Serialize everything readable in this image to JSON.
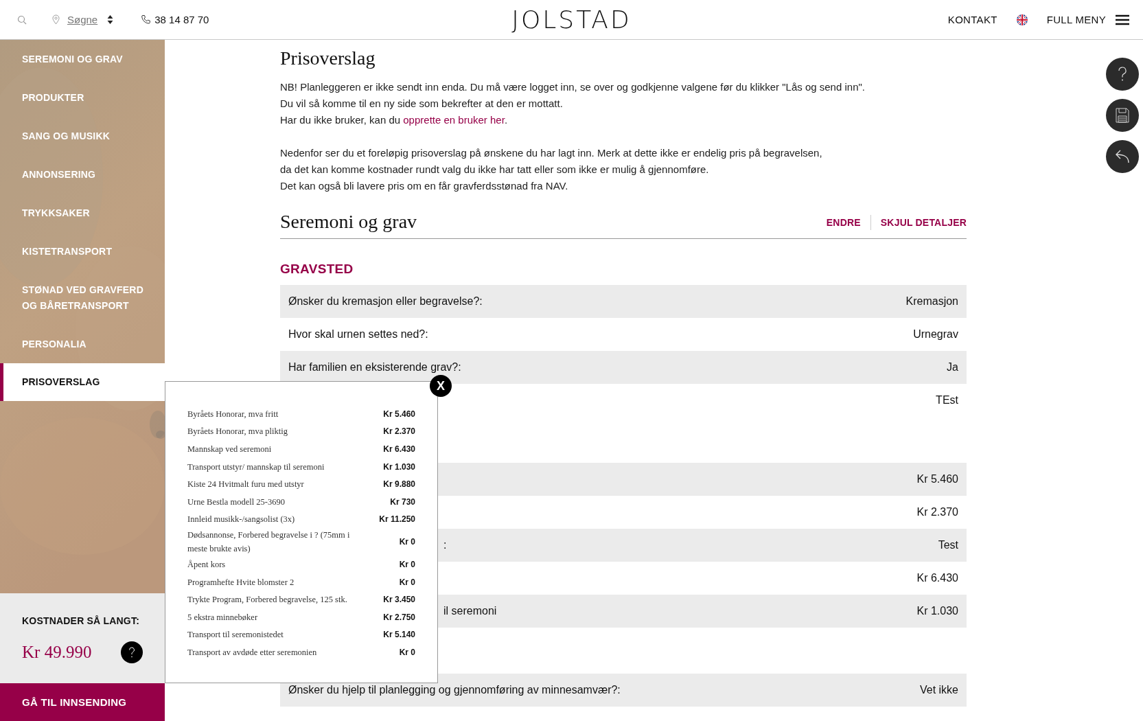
{
  "header": {
    "location": "Søgne",
    "phone": "38 14 87 70",
    "logo": "JOLSTAD",
    "contact": "KONTAKT",
    "menu": "FULL MENY"
  },
  "sidebar": {
    "items": [
      {
        "label": "SEREMONI OG GRAV",
        "selected": false
      },
      {
        "label": "PRODUKTER",
        "selected": false
      },
      {
        "label": "SANG OG MUSIKK",
        "selected": false
      },
      {
        "label": "ANNONSERING",
        "selected": false
      },
      {
        "label": "TRYKKSAKER",
        "selected": false
      },
      {
        "label": "KISTETRANSPORT",
        "selected": false
      },
      {
        "label": "STØNAD VED GRAVFERD OG BÅRETRANSPORT",
        "selected": false
      },
      {
        "label": "PERSONALIA",
        "selected": false
      },
      {
        "label": "PRISOVERSLAG",
        "selected": true
      }
    ],
    "cost_label": "KOSTNADER SÅ LANGT:",
    "cost_value": "Kr 49.990",
    "submit": "GÅ TIL INNSENDING"
  },
  "page": {
    "title": "Prisoverslag",
    "intro": [
      {
        "text": "NB! Planleggeren er ikke sendt inn enda. Du må være logget inn, se over og godkjenne valgene før du klikker \"Lås og send inn\"."
      },
      {
        "text": "Du vil så komme til en ny side som bekrefter at den er mottatt."
      },
      {
        "text": "Har du ikke bruker, kan du ",
        "link": "opprette en bruker her",
        "after": "."
      }
    ],
    "notice": [
      "Nedenfor ser du et foreløpig prisoverslag på ønskene du har lagt inn. Merk at dette ikke er endelig pris på begravelsen,",
      "da det kan komme kostnader rundt valg du ikke har tatt eller som ikke er mulig å gjennomføre.",
      "Det kan også bli lavere pris om en får gravferdsstønad fra NAV."
    ]
  },
  "section": {
    "title": "Seremoni og grav",
    "actions": [
      "ENDRE",
      "SKJUL DETALJER"
    ],
    "groups": [
      {
        "heading": "GRAVSTED",
        "rows": [
          {
            "label": "Ønsker du kremasjon eller begravelse?:",
            "value": "Kremasjon"
          },
          {
            "label": "Hvor skal urnen settes ned?:",
            "value": "Urnegrav"
          },
          {
            "label": "Har familien en eksisterende grav?:",
            "value": "Ja"
          },
          {
            "value": "TEst"
          }
        ]
      },
      {
        "rows": [
          {
            "value": "Kr 5.460"
          },
          {
            "value": "Kr 2.370"
          },
          {
            "label_tail": ":",
            "value": "Test"
          },
          {
            "value": "Kr 6.430"
          },
          {
            "label_tail": "il seremoni",
            "value": "Kr 1.030"
          }
        ]
      },
      {
        "rows": [
          {
            "label": "Ønsker du hjelp til planlegging og gjennomføring av minnesamvær?:",
            "value": "Vet ikke"
          }
        ]
      }
    ]
  },
  "popup": {
    "close": "X",
    "items": [
      {
        "name": "Byråets Honorar, mva fritt",
        "amount": "Kr 5.460"
      },
      {
        "name": "Byråets Honorar, mva pliktig",
        "amount": "Kr 2.370"
      },
      {
        "name": "Mannskap ved seremoni",
        "amount": "Kr 6.430"
      },
      {
        "name": "Transport utstyr/ mannskap til seremoni",
        "amount": "Kr 1.030"
      },
      {
        "name": "Kiste 24 Hvitmalt furu med utstyr",
        "amount": "Kr 9.880"
      },
      {
        "name": "Urne Bestla modell 25-3690",
        "amount": "Kr 730"
      },
      {
        "name": "Innleid musikk-/sangsolist (3x)",
        "amount": "Kr 11.250"
      },
      {
        "name": "Dødsannonse, Forbered begravelse i ? (75mm i meste brukte avis)",
        "amount": "Kr 0"
      },
      {
        "name": "Åpent kors",
        "amount": "Kr 0"
      },
      {
        "name": "Programhefte Hvite blomster 2",
        "amount": "Kr 0"
      },
      {
        "name": "Trykte Program, Forbered begravelse, 125 stk.",
        "amount": "Kr 3.450"
      },
      {
        "name": "5 ekstra minnebøker",
        "amount": "Kr 2.750"
      },
      {
        "name": "Transport til seremonistedet",
        "amount": "Kr 5.140"
      },
      {
        "name": "Transport av avdøde etter seremonien",
        "amount": "Kr 0"
      }
    ]
  }
}
